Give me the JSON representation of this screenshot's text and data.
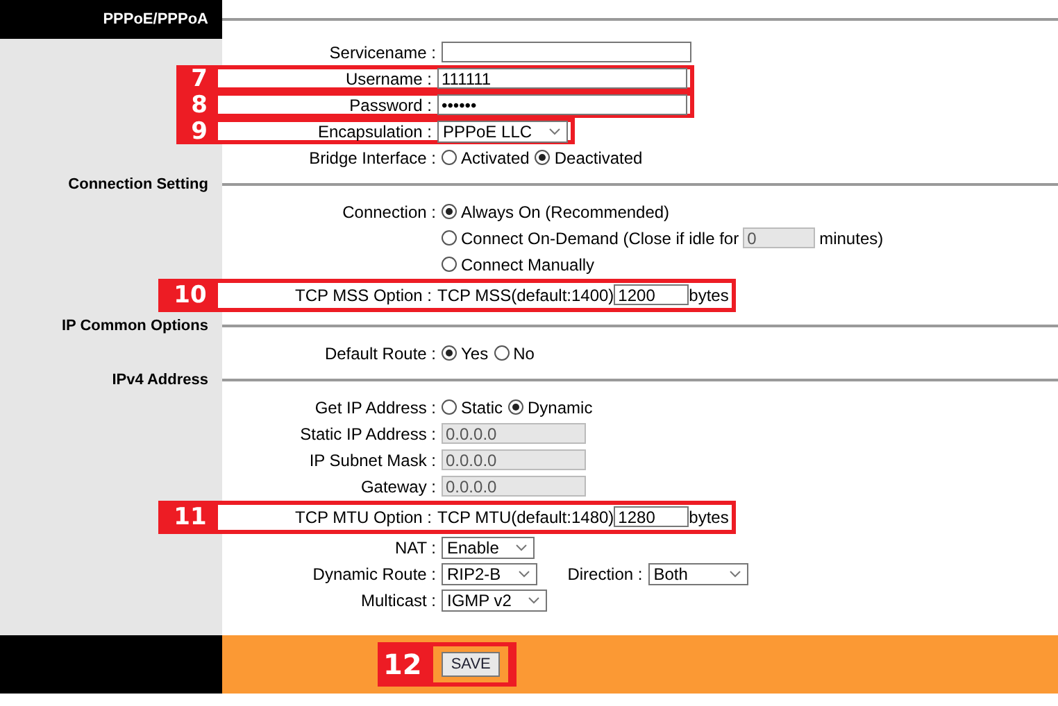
{
  "header": {
    "title": "PPPoE/PPPoA"
  },
  "sections": [
    {
      "rows": [
        {
          "kind": "text",
          "label": "Servicename :"
        },
        {
          "kind": "text",
          "label": "Username :",
          "value": "111111",
          "callout": "7"
        },
        {
          "kind": "text",
          "label": "Password :",
          "value": "••••••",
          "callout": "8"
        },
        {
          "kind": "select",
          "label": "Encapsulation :",
          "value": "PPPoE LLC",
          "callout": "9"
        },
        {
          "kind": "radio",
          "label": "Bridge Interface :",
          "options": [
            {
              "label": "Activated",
              "selected": false
            },
            {
              "label": "Deactivated",
              "selected": true
            }
          ]
        }
      ]
    },
    {
      "label": "Connection Setting",
      "rows": [
        {
          "kind": "radio",
          "label": "Connection :",
          "options": [
            {
              "label": "Always On (Recommended)",
              "selected": true
            }
          ]
        },
        {
          "kind": "radio",
          "options": [
            {
              "label": "Connect On-Demand (Close if idle for",
              "selected": false,
              "field": "0",
              "suffix": "minutes)"
            }
          ]
        },
        {
          "kind": "radio",
          "options": [
            {
              "label": "Connect Manually",
              "selected": false
            }
          ]
        },
        {
          "kind": "option",
          "label": "TCP MSS Option :",
          "prefix": "TCP MSS(default:1400)",
          "value": "1200",
          "suffix": "bytes",
          "callout": "10"
        }
      ]
    },
    {
      "label": "IP Common Options",
      "rows": [
        {
          "kind": "radio",
          "label": "Default Route :",
          "options": [
            {
              "label": "Yes",
              "selected": true
            },
            {
              "label": "No",
              "selected": false
            }
          ]
        }
      ]
    },
    {
      "label": "IPv4 Address",
      "rows": [
        {
          "kind": "radio",
          "label": "Get IP Address :",
          "options": [
            {
              "label": "Static",
              "selected": false
            },
            {
              "label": "Dynamic",
              "selected": true
            }
          ]
        },
        {
          "kind": "disabled",
          "label": "Static IP Address :",
          "value": "0.0.0.0"
        },
        {
          "kind": "disabled",
          "label": "IP Subnet Mask :",
          "value": "0.0.0.0"
        },
        {
          "kind": "disabled",
          "label": "Gateway :",
          "value": "0.0.0.0"
        },
        {
          "kind": "option",
          "label": "TCP MTU Option :",
          "prefix": "TCP MTU(default:1480)",
          "value": "1280",
          "suffix": "bytes",
          "callout": "11"
        },
        {
          "kind": "select",
          "label": "NAT :",
          "value": "Enable"
        },
        {
          "kind": "select",
          "label": "Dynamic Route :",
          "value": "RIP2-B",
          "extra": {
            "label": "Direction :",
            "value": "Both"
          }
        },
        {
          "kind": "select",
          "label": "Multicast :",
          "value": "IGMP v2"
        }
      ]
    }
  ],
  "footer": {
    "button": "SAVE",
    "callout": "12"
  }
}
